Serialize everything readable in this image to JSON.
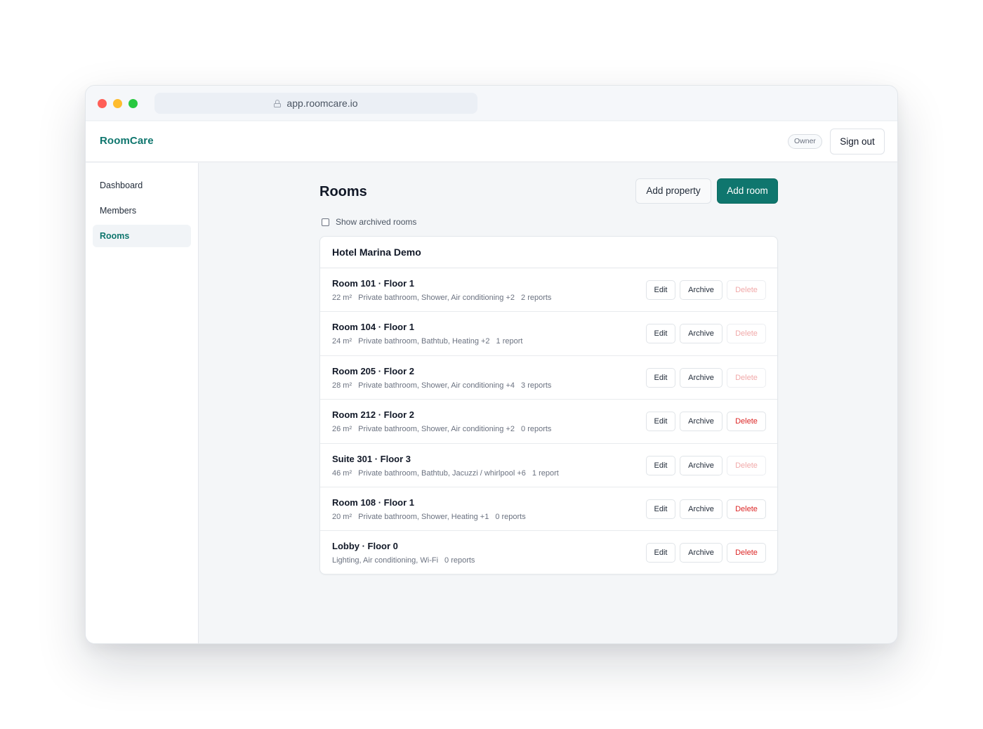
{
  "browser": {
    "url": "app.roomcare.io"
  },
  "header": {
    "brand": "RoomCare",
    "role_badge": "Owner",
    "signout_label": "Sign out"
  },
  "sidebar": {
    "items": [
      {
        "label": "Dashboard",
        "active": false
      },
      {
        "label": "Members",
        "active": false
      },
      {
        "label": "Rooms",
        "active": true
      }
    ]
  },
  "main": {
    "title": "Rooms",
    "add_property_label": "Add property",
    "add_room_label": "Add room",
    "show_archived_label": "Show archived rooms",
    "show_archived_checked": false,
    "property_name": "Hotel Marina Demo",
    "action_labels": {
      "edit": "Edit",
      "archive": "Archive",
      "delete": "Delete"
    },
    "rooms": [
      {
        "name": "Room 101 · Floor 1",
        "size": "22 m²",
        "amenities": "Private bathroom, Shower, Air conditioning +2",
        "reports": "2 reports",
        "delete_enabled": false
      },
      {
        "name": "Room 104 · Floor 1",
        "size": "24 m²",
        "amenities": "Private bathroom, Bathtub, Heating +2",
        "reports": "1 report",
        "delete_enabled": false
      },
      {
        "name": "Room 205 · Floor 2",
        "size": "28 m²",
        "amenities": "Private bathroom, Shower, Air conditioning +4",
        "reports": "3 reports",
        "delete_enabled": false
      },
      {
        "name": "Room 212 · Floor 2",
        "size": "26 m²",
        "amenities": "Private bathroom, Shower, Air conditioning +2",
        "reports": "0 reports",
        "delete_enabled": true
      },
      {
        "name": "Suite 301 · Floor 3",
        "size": "46 m²",
        "amenities": "Private bathroom, Bathtub, Jacuzzi / whirlpool +6",
        "reports": "1 report",
        "delete_enabled": false
      },
      {
        "name": "Room 108 · Floor 1",
        "size": "20 m²",
        "amenities": "Private bathroom, Shower, Heating +1",
        "reports": "0 reports",
        "delete_enabled": true
      },
      {
        "name": "Lobby · Floor 0",
        "size": "",
        "amenities": "Lighting, Air conditioning, Wi-Fi",
        "reports": "0 reports",
        "delete_enabled": true
      }
    ]
  },
  "colors": {
    "accent": "#0f766e",
    "danger": "#dc2626",
    "danger_disabled": "#f1a9a9"
  }
}
